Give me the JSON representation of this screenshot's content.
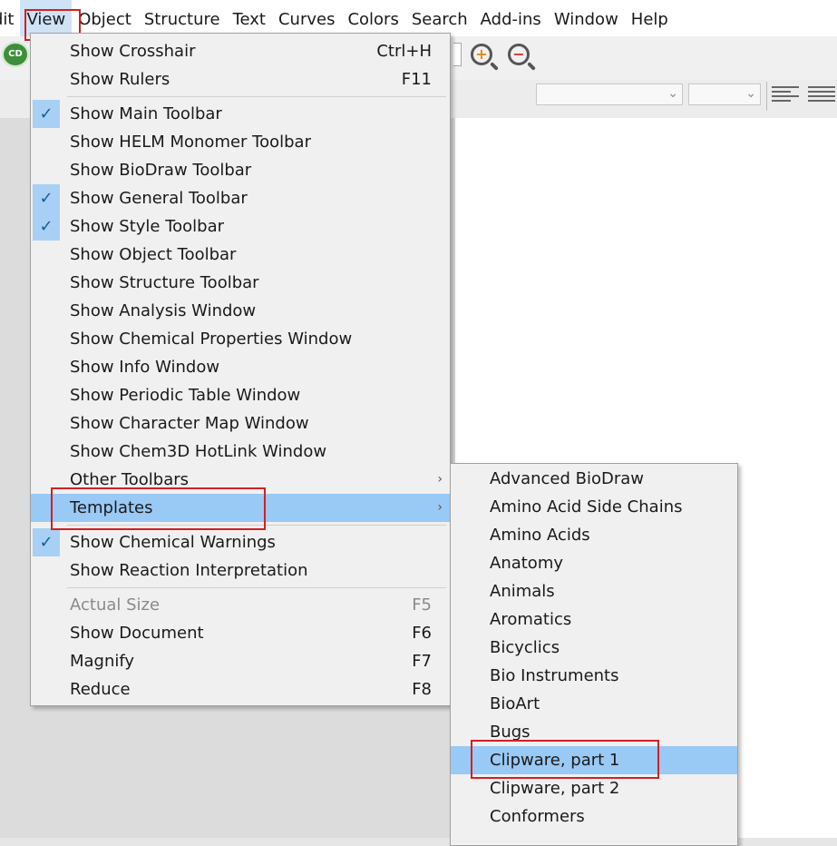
{
  "menubar": {
    "items": [
      "dit",
      "View",
      "Object",
      "Structure",
      "Text",
      "Curves",
      "Colors",
      "Search",
      "Add-ins",
      "Window",
      "Help"
    ]
  },
  "toolbar": {
    "logo_text": "CD",
    "zoom_in_icon": "zoom-in-icon",
    "zoom_out_icon": "zoom-out-icon"
  },
  "view_menu": {
    "items": [
      {
        "label": "Show Crosshair",
        "shortcut": "Ctrl+H",
        "checked": false
      },
      {
        "label": "Show Rulers",
        "shortcut": "F11",
        "checked": false
      },
      {
        "label": "Show Main Toolbar",
        "checked": true
      },
      {
        "label": "Show HELM Monomer Toolbar",
        "checked": false
      },
      {
        "label": "Show BioDraw Toolbar",
        "checked": false
      },
      {
        "label": "Show General Toolbar",
        "checked": true
      },
      {
        "label": "Show Style Toolbar",
        "checked": true
      },
      {
        "label": "Show Object Toolbar",
        "checked": false
      },
      {
        "label": "Show Structure Toolbar",
        "checked": false
      },
      {
        "label": "Show Analysis Window",
        "checked": false
      },
      {
        "label": "Show Chemical Properties Window",
        "checked": false
      },
      {
        "label": "Show Info Window",
        "checked": false
      },
      {
        "label": "Show Periodic Table Window",
        "checked": false
      },
      {
        "label": "Show Character Map Window",
        "checked": false
      },
      {
        "label": "Show Chem3D HotLink Window",
        "checked": false
      },
      {
        "label": "Other Toolbars",
        "submenu": true
      },
      {
        "label": "Templates",
        "submenu": true,
        "highlighted": true
      },
      {
        "label": "Show Chemical Warnings",
        "checked": true
      },
      {
        "label": "Show Reaction Interpretation",
        "checked": false
      },
      {
        "label": "Actual Size",
        "shortcut": "F5",
        "disabled": true
      },
      {
        "label": "Show Document",
        "shortcut": "F6"
      },
      {
        "label": "Magnify",
        "shortcut": "F7"
      },
      {
        "label": "Reduce",
        "shortcut": "F8"
      }
    ]
  },
  "templates_menu": {
    "items": [
      "Advanced BioDraw",
      "Amino Acid Side Chains",
      "Amino Acids",
      "Anatomy",
      "Animals",
      "Aromatics",
      "Bicyclics",
      "Bio Instruments",
      "BioArt",
      "Bugs",
      "Clipware, part 1",
      "Clipware, part 2",
      "Conformers"
    ],
    "highlighted_index": 10
  },
  "colors": {
    "highlight": "#99c9f5",
    "check_bg": "#a8d0f4",
    "annotation_red": "#d42020"
  }
}
